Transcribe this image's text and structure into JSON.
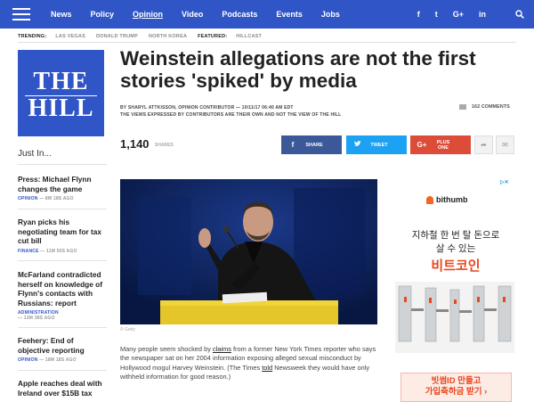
{
  "nav": {
    "links": [
      "News",
      "Policy",
      "Opinion",
      "Video",
      "Podcasts",
      "Events",
      "Jobs"
    ],
    "active": "Opinion",
    "social": [
      "f",
      "t",
      "G+",
      "in"
    ]
  },
  "trending": {
    "label": "TRENDING:",
    "tags": [
      "LAS VEGAS",
      "DONALD TRUMP",
      "NORTH KOREA"
    ],
    "featured_label": "FEATURED:",
    "featured": "HILLCAST"
  },
  "logo": {
    "line1": "THE",
    "line2": "HILL"
  },
  "just_in": {
    "title": "Just In...",
    "stories": [
      {
        "headline": "Press: Michael Flynn changes the game",
        "section": "OPINION",
        "time": "8M 18S AGO"
      },
      {
        "headline": "Ryan picks his negotiating team for tax cut bill",
        "section": "FINANCE",
        "time": "11M 55S AGO"
      },
      {
        "headline": "McFarland contradicted herself on knowledge of Flynn's contacts with Russians: report",
        "section": "ADMINISTRATION",
        "time": "13M 38S AGO"
      },
      {
        "headline": "Feehery: End of objective reporting",
        "section": "OPINION",
        "time": "18M 18S AGO"
      },
      {
        "headline": "Apple reaches deal with Ireland over $15B tax",
        "section": "",
        "time": ""
      }
    ]
  },
  "article": {
    "headline": "Weinstein allegations are not the first stories 'spiked' by media",
    "byline": "BY SHARYL ATTKISSON, OPINION CONTRIBUTOR — 10/11/17 06:40 AM EDT",
    "disclaimer": "THE VIEWS EXPRESSED BY CONTRIBUTORS ARE THEIR OWN AND NOT THE VIEW OF THE HILL",
    "comments": "162 COMMENTS",
    "shares": "1,140",
    "shares_label": "SHARES",
    "share_buttons": {
      "facebook": "SHARE",
      "twitter": "TWEET",
      "google": "PLUS ONE"
    },
    "photo_credit": "© Getty",
    "body_1": "Many people seem shocked by ",
    "body_link1": "claims",
    "body_2": " from a former New York Times reporter who says the newspaper sat on her 2004 information exposing alleged sexual misconduct by Hollywood mogul Harvey Weinstein. (The Times ",
    "body_link2": "told",
    "body_3": " Newsweek they would have only withheld information for good reason.)"
  },
  "ad": {
    "brand": "bithumb",
    "line1": "지하철 한 번 탈 돈으로",
    "line2": "살 수 있는",
    "line3": "비트코인",
    "cta_line1": "빗썸ID 만들고",
    "cta_line2": "가입축하금 받기 ›"
  },
  "colors": {
    "brand_blue": "#2f55c6",
    "facebook": "#3b5998",
    "twitter": "#1da1f2",
    "google": "#dd4b39",
    "ad_orange": "#e8471f"
  }
}
